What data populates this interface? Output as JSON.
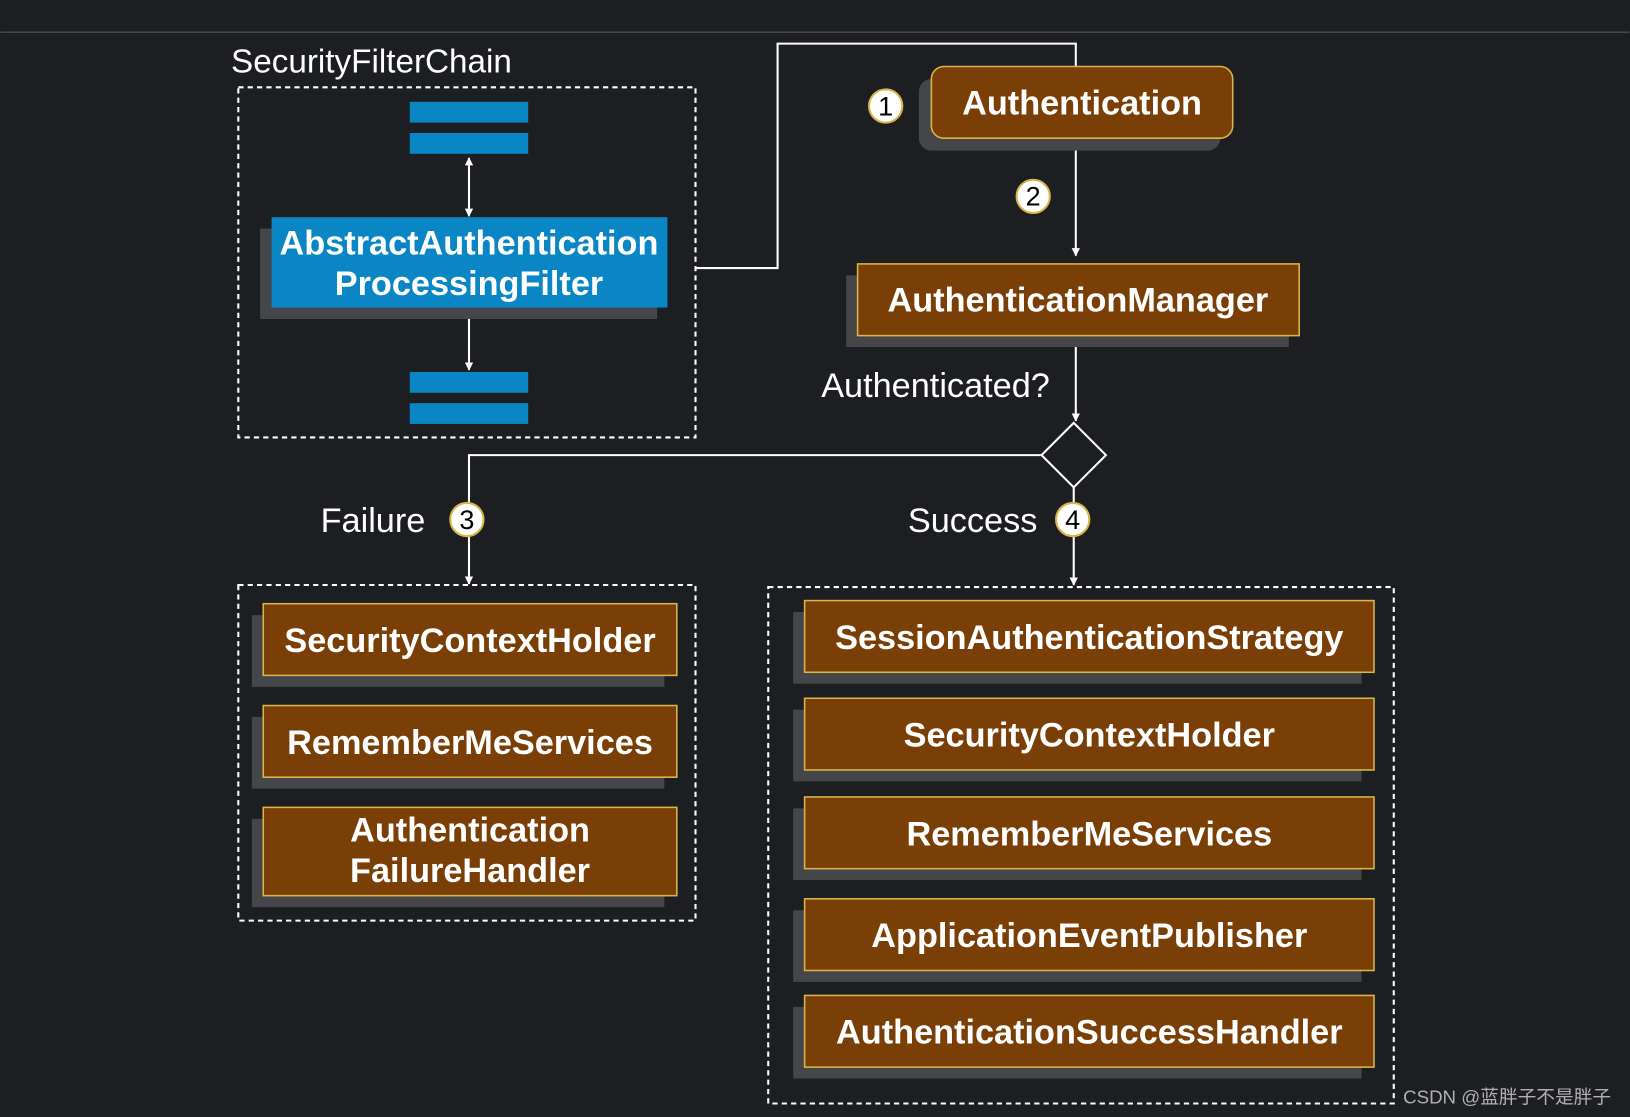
{
  "colors": {
    "background": "#1c1e22",
    "filter_blue": "#0a86c4",
    "component_brown": "#7a3f06",
    "component_border": "#d8b648",
    "shadow": "#45464a",
    "line": "#ffffff"
  },
  "filter_chain": {
    "title": "SecurityFilterChain",
    "filter_label": [
      "AbstractAuthentication",
      "ProcessingFilter"
    ]
  },
  "flow": {
    "authentication": "Authentication",
    "manager": "AuthenticationManager",
    "decision": "Authenticated?",
    "failure_label": "Failure",
    "success_label": "Success",
    "steps": [
      "1",
      "2",
      "3",
      "4"
    ]
  },
  "failure_components": [
    [
      "SecurityContextHolder"
    ],
    [
      "RememberMeServices"
    ],
    [
      "Authentication",
      "FailureHandler"
    ]
  ],
  "success_components": [
    [
      "SessionAuthenticationStrategy"
    ],
    [
      "SecurityContextHolder"
    ],
    [
      "RememberMeServices"
    ],
    [
      "ApplicationEventPublisher"
    ],
    [
      "AuthenticationSuccessHandler"
    ]
  ],
  "watermark": "CSDN @蓝胖子不是胖子"
}
